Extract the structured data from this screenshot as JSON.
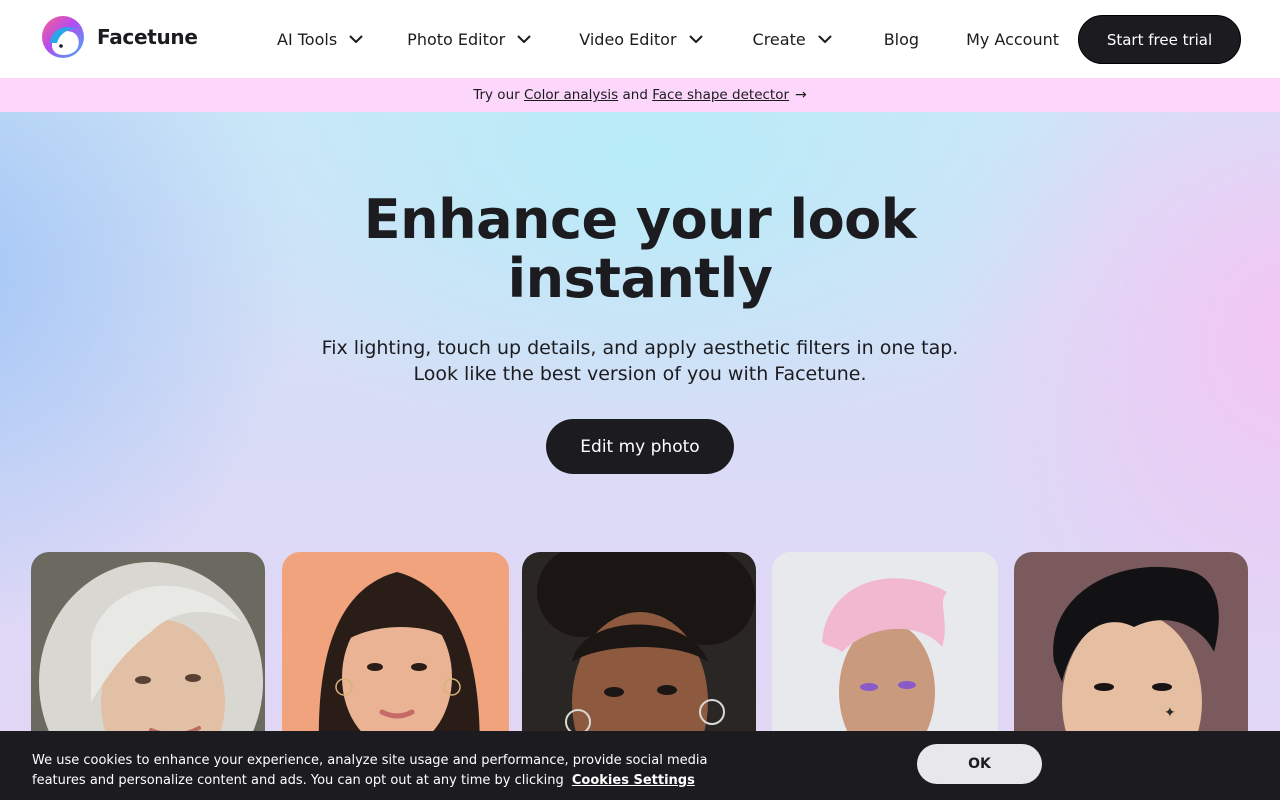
{
  "brand": {
    "name": "Facetune",
    "logo_icon": "facetune-logo-icon"
  },
  "nav": {
    "items": [
      {
        "label": "AI Tools",
        "has_dropdown": true
      },
      {
        "label": "Photo Editor",
        "has_dropdown": true
      },
      {
        "label": "Video Editor",
        "has_dropdown": true
      },
      {
        "label": "Create",
        "has_dropdown": true
      },
      {
        "label": "Blog",
        "has_dropdown": false
      },
      {
        "label": "My Account",
        "has_dropdown": false
      }
    ],
    "cta": "Start free trial"
  },
  "promo": {
    "prefix": "Try our",
    "link1": "Color analysis",
    "middle": "and",
    "link2": "Face shape detector",
    "arrow": "→"
  },
  "hero": {
    "title_line1": "Enhance your look",
    "title_line2": "instantly",
    "subtitle_line1": "Fix lighting, touch up details, and apply aesthetic filters in one tap.",
    "subtitle_line2": "Look like the best version of you with Facetune.",
    "cta": "Edit my photo"
  },
  "gallery": {
    "cards": [
      {
        "name": "portrait-silver-hair",
        "bg": "#6b6a60",
        "skin": "#e2c0a6",
        "hair": "#dcdcd8"
      },
      {
        "name": "portrait-dark-long-hair",
        "bg": "#f0a37d",
        "skin": "#e9b394",
        "hair": "#2a1d18"
      },
      {
        "name": "portrait-curly-hair",
        "bg": "#2a2624",
        "skin": "#8d5a3f",
        "hair": "#1b1513"
      },
      {
        "name": "portrait-pink-hair",
        "bg": "#e8e9ec",
        "skin": "#c99a7e",
        "hair": "#f2b8cf"
      },
      {
        "name": "portrait-black-quiff",
        "bg": "#7a5a5c",
        "skin": "#e6bfa2",
        "hair": "#121214"
      }
    ]
  },
  "cookie": {
    "text": "We use cookies to enhance your experience, analyze site usage and performance, provide social media features and personalize content and ads. You can opt out at any time by clicking",
    "link": "Cookies Settings",
    "ok": "OK"
  },
  "colors": {
    "primary_dark": "#1c1c20",
    "promo_bg": "#fcd6fb",
    "cookie_bg": "#1c1c20",
    "ok_bg": "#e8e8ea"
  }
}
